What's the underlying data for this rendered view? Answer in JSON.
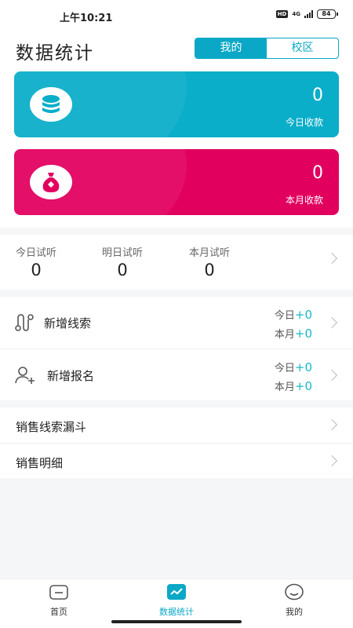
{
  "status": {
    "time": "上午10:21",
    "hd": "HD",
    "network": "4G",
    "battery": "84"
  },
  "header": {
    "title": "数据统计",
    "segments": [
      {
        "label": "我的",
        "active": true
      },
      {
        "label": "校区",
        "active": false
      }
    ]
  },
  "cards": {
    "today": {
      "amount": "0",
      "label": "今日收款"
    },
    "month": {
      "amount": "0",
      "label": "本月收款"
    }
  },
  "trials": {
    "items": [
      {
        "label": "今日试听",
        "value": "0"
      },
      {
        "label": "明日试听",
        "value": "0"
      },
      {
        "label": "本月试听",
        "value": "0"
      }
    ]
  },
  "leads": [
    {
      "name": "新增线索",
      "today_label": "今日",
      "today_value": "+0",
      "month_label": "本月",
      "month_value": "+0"
    },
    {
      "name": "新增报名",
      "today_label": "今日",
      "today_value": "+0",
      "month_label": "本月",
      "month_value": "+0"
    }
  ],
  "menu": [
    {
      "label": "销售线索漏斗"
    },
    {
      "label": "销售明细"
    }
  ],
  "tabbar": [
    {
      "label": "首页",
      "active": false
    },
    {
      "label": "数据统计",
      "active": true
    },
    {
      "label": "我的",
      "active": false
    }
  ],
  "colors": {
    "accent": "#0aa8c6",
    "teal_card": "#0aaec9",
    "pink_card": "#e2005f",
    "plus": "#18b7c9"
  }
}
